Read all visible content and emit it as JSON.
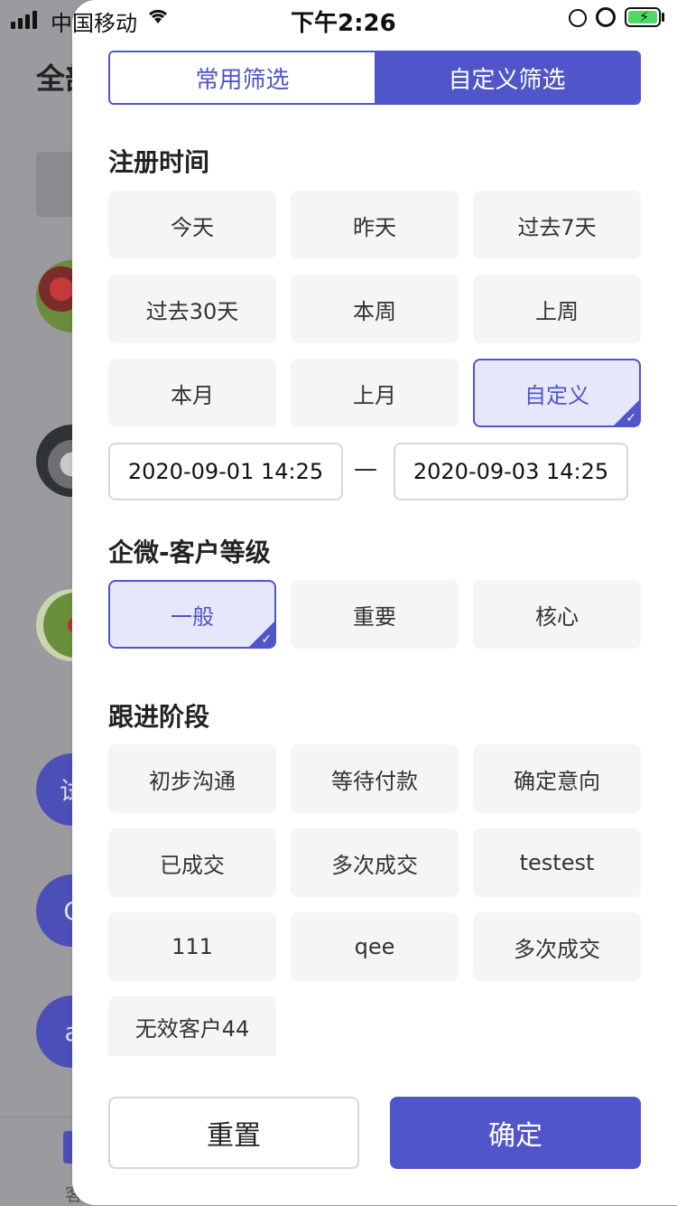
{
  "status_bar": {
    "carrier": "中国移动",
    "time": "下午2:26"
  },
  "background": {
    "title": "全部",
    "tab_label": "客",
    "avatar_letters": [
      "试",
      "C",
      "a"
    ]
  },
  "tabs": [
    {
      "label": "常用筛选",
      "active": false
    },
    {
      "label": "自定义筛选",
      "active": true
    }
  ],
  "sections": {
    "register_time": {
      "title": "注册时间",
      "options": [
        "今天",
        "昨天",
        "过去7天",
        "过去30天",
        "本周",
        "上周",
        "本月",
        "上月",
        "自定义"
      ],
      "selected": "自定义",
      "start": "2020-09-01 14:25",
      "end": "2020-09-03 14:25",
      "separator": "—"
    },
    "customer_level": {
      "title": "企微-客户等级",
      "options": [
        "一般",
        "重要",
        "核心"
      ],
      "selected": "一般"
    },
    "follow_stage": {
      "title": "跟进阶段",
      "options": [
        "初步沟通",
        "等待付款",
        "确定意向",
        "已成交",
        "多次成交",
        "testest",
        "111",
        "qee",
        "多次成交",
        "无效客户44"
      ]
    }
  },
  "buttons": {
    "reset": "重置",
    "confirm": "确定"
  },
  "colors": {
    "accent": "#5055c9",
    "chip_bg": "#f5f5f7",
    "selected_bg": "#e7e7fb"
  }
}
